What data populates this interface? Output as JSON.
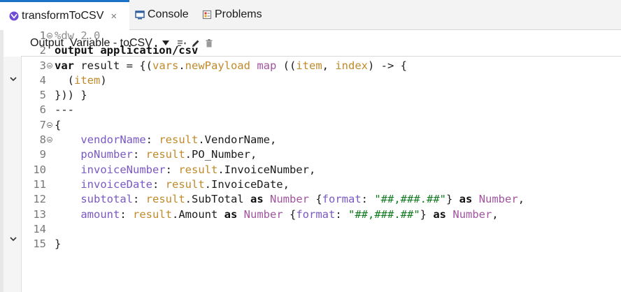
{
  "tabs": {
    "active": {
      "label": "transformToCSV",
      "close": "×"
    },
    "console": {
      "label": "Console"
    },
    "problems": {
      "label": "Problems"
    }
  },
  "header": {
    "title": "Output  Variable - toCSV",
    "icons": [
      "dropdown-triangle-icon",
      "add-output-icon",
      "edit-pencil-icon",
      "delete-trash-icon"
    ]
  },
  "colors": {
    "accent": "#1a73c9",
    "keyword": "#101010",
    "variable": "#c08a2a",
    "function": "#a2549f",
    "field_key": "#7a58c4",
    "string": "#137a23",
    "comment": "#8f8f8f"
  },
  "code": {
    "line_numbers": [
      "1",
      "2",
      "3",
      "4",
      "5",
      "6",
      "7",
      "8",
      "9",
      "10",
      "11",
      "12",
      "13",
      "14",
      "15"
    ],
    "lines": [
      {
        "n": "1",
        "fold": true,
        "tokens": [
          {
            "t": "%dw 2.0",
            "c": "cmt"
          }
        ]
      },
      {
        "n": "2",
        "fold": false,
        "tokens": [
          {
            "t": "output application/csv",
            "c": "kw"
          }
        ]
      },
      {
        "n": "3",
        "fold": true,
        "tokens": [
          {
            "t": "var",
            "c": "kw"
          },
          {
            "t": " result = {(",
            "c": "plain"
          },
          {
            "t": "vars",
            "c": "var"
          },
          {
            "t": ".",
            "c": "plain"
          },
          {
            "t": "newPayload",
            "c": "var"
          },
          {
            "t": " ",
            "c": "plain"
          },
          {
            "t": "map",
            "c": "fn"
          },
          {
            "t": " ((",
            "c": "plain"
          },
          {
            "t": "item",
            "c": "var"
          },
          {
            "t": ", ",
            "c": "plain"
          },
          {
            "t": "index",
            "c": "var"
          },
          {
            "t": ") -> {",
            "c": "plain"
          }
        ]
      },
      {
        "n": "4",
        "fold": false,
        "tokens": [
          {
            "t": "  (",
            "c": "plain"
          },
          {
            "t": "item",
            "c": "var"
          },
          {
            "t": ")",
            "c": "plain"
          }
        ]
      },
      {
        "n": "5",
        "fold": false,
        "tokens": [
          {
            "t": "})) }",
            "c": "plain"
          }
        ]
      },
      {
        "n": "6",
        "fold": false,
        "tokens": [
          {
            "t": "---",
            "c": "plain"
          }
        ]
      },
      {
        "n": "7",
        "fold": true,
        "tokens": [
          {
            "t": "{",
            "c": "plain"
          }
        ]
      },
      {
        "n": "8",
        "fold": true,
        "tokens": [
          {
            "t": "    ",
            "c": "plain"
          },
          {
            "t": "vendorName",
            "c": "key"
          },
          {
            "t": ": ",
            "c": "plain"
          },
          {
            "t": "result",
            "c": "var"
          },
          {
            "t": ".VendorName,",
            "c": "plain"
          }
        ]
      },
      {
        "n": "9",
        "fold": false,
        "tokens": [
          {
            "t": "    ",
            "c": "plain"
          },
          {
            "t": "poNumber",
            "c": "key"
          },
          {
            "t": ": ",
            "c": "plain"
          },
          {
            "t": "result",
            "c": "var"
          },
          {
            "t": ".PO_Number,",
            "c": "plain"
          }
        ]
      },
      {
        "n": "10",
        "fold": false,
        "tokens": [
          {
            "t": "    ",
            "c": "plain"
          },
          {
            "t": "invoiceNumber",
            "c": "key"
          },
          {
            "t": ": ",
            "c": "plain"
          },
          {
            "t": "result",
            "c": "var"
          },
          {
            "t": ".InvoiceNumber,",
            "c": "plain"
          }
        ]
      },
      {
        "n": "11",
        "fold": false,
        "tokens": [
          {
            "t": "    ",
            "c": "plain"
          },
          {
            "t": "invoiceDate",
            "c": "key"
          },
          {
            "t": ": ",
            "c": "plain"
          },
          {
            "t": "result",
            "c": "var"
          },
          {
            "t": ".InvoiceDate,",
            "c": "plain"
          }
        ]
      },
      {
        "n": "12",
        "fold": false,
        "tokens": [
          {
            "t": "    ",
            "c": "plain"
          },
          {
            "t": "subtotal",
            "c": "key"
          },
          {
            "t": ": ",
            "c": "plain"
          },
          {
            "t": "result",
            "c": "var"
          },
          {
            "t": ".SubTotal ",
            "c": "plain"
          },
          {
            "t": "as",
            "c": "kw"
          },
          {
            "t": " ",
            "c": "plain"
          },
          {
            "t": "Number",
            "c": "type"
          },
          {
            "t": " {",
            "c": "plain"
          },
          {
            "t": "format",
            "c": "key"
          },
          {
            "t": ": ",
            "c": "plain"
          },
          {
            "t": "\"##,###.##\"",
            "c": "str"
          },
          {
            "t": "} ",
            "c": "plain"
          },
          {
            "t": "as",
            "c": "kw"
          },
          {
            "t": " ",
            "c": "plain"
          },
          {
            "t": "Number",
            "c": "type"
          },
          {
            "t": ",",
            "c": "plain"
          }
        ]
      },
      {
        "n": "13",
        "fold": false,
        "tokens": [
          {
            "t": "    ",
            "c": "plain"
          },
          {
            "t": "amount",
            "c": "key"
          },
          {
            "t": ": ",
            "c": "plain"
          },
          {
            "t": "result",
            "c": "var"
          },
          {
            "t": ".Amount ",
            "c": "plain"
          },
          {
            "t": "as",
            "c": "kw"
          },
          {
            "t": " ",
            "c": "plain"
          },
          {
            "t": "Number",
            "c": "type"
          },
          {
            "t": " {",
            "c": "plain"
          },
          {
            "t": "format",
            "c": "key"
          },
          {
            "t": ": ",
            "c": "plain"
          },
          {
            "t": "\"##,###.##\"",
            "c": "str"
          },
          {
            "t": "} ",
            "c": "plain"
          },
          {
            "t": "as",
            "c": "kw"
          },
          {
            "t": " ",
            "c": "plain"
          },
          {
            "t": "Number",
            "c": "type"
          },
          {
            "t": ",",
            "c": "plain"
          }
        ]
      },
      {
        "n": "14",
        "fold": false,
        "tokens": [
          {
            "t": "",
            "c": "plain"
          }
        ]
      },
      {
        "n": "15",
        "fold": false,
        "tokens": [
          {
            "t": "}",
            "c": "plain"
          }
        ]
      }
    ]
  }
}
